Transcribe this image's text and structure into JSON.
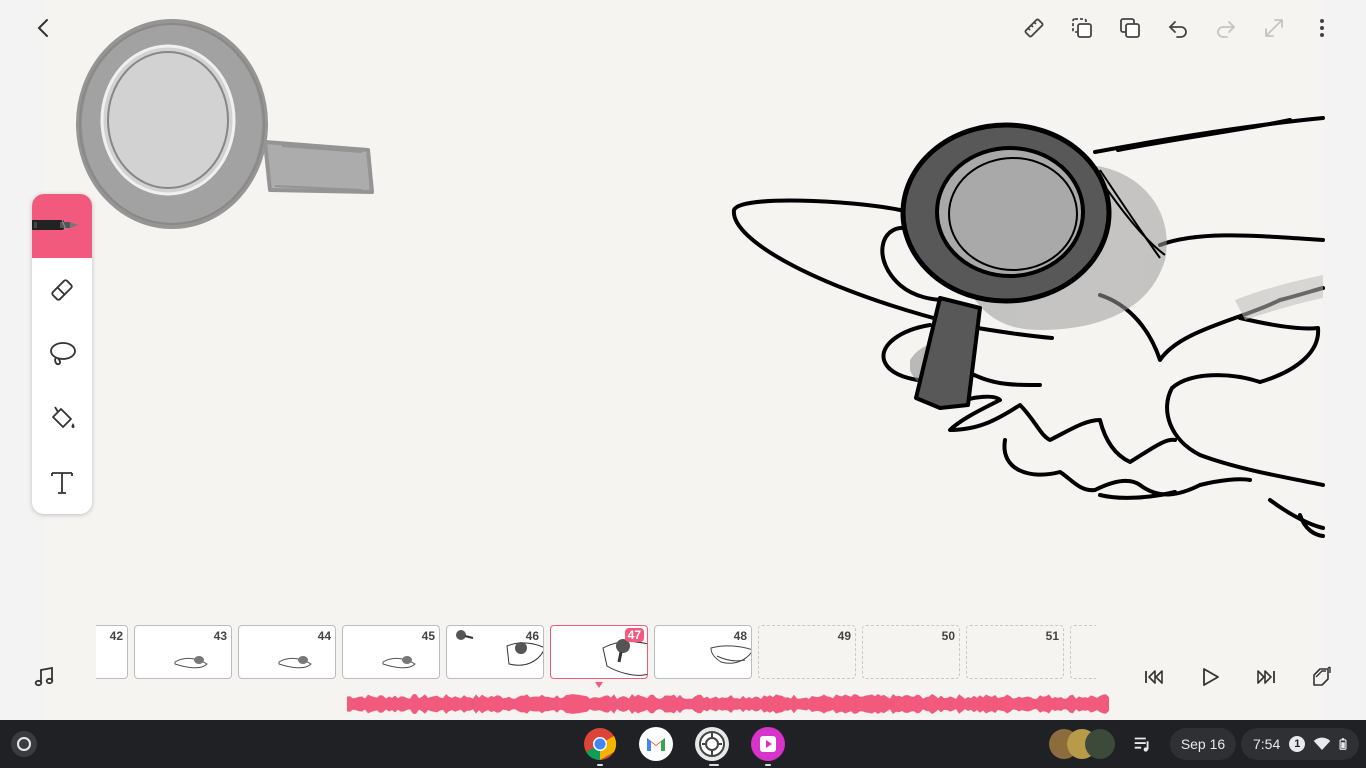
{
  "toolbar": {
    "back_icon": "chevron-left-icon",
    "ruler_icon": "ruler-icon",
    "onion_icon": "onion-skin-icon",
    "copy_icon": "duplicate-icon",
    "undo_icon": "undo-icon",
    "redo_icon": "redo-icon",
    "fullscreen_icon": "expand-icon",
    "more_icon": "more-vert-icon"
  },
  "tools": [
    {
      "name": "pen",
      "icon": "pen-icon",
      "active": true
    },
    {
      "name": "eraser",
      "icon": "eraser-icon",
      "active": false
    },
    {
      "name": "lasso",
      "icon": "lasso-icon",
      "active": false
    },
    {
      "name": "fill",
      "icon": "paint-bucket-icon",
      "active": false
    },
    {
      "name": "text",
      "icon": "text-icon",
      "active": false
    }
  ],
  "frames": [
    {
      "num": "42",
      "content": "partial"
    },
    {
      "num": "43",
      "content": "small"
    },
    {
      "num": "44",
      "content": "small"
    },
    {
      "num": "45",
      "content": "small"
    },
    {
      "num": "46",
      "content": "medium"
    },
    {
      "num": "47",
      "content": "current"
    },
    {
      "num": "48",
      "content": "hand"
    },
    {
      "num": "49",
      "content": "empty"
    },
    {
      "num": "50",
      "content": "empty"
    },
    {
      "num": "51",
      "content": "empty"
    }
  ],
  "current_frame": "47",
  "playback": {
    "music_icon": "music-note-icon",
    "first_icon": "skip-to-start-icon",
    "play_icon": "play-icon",
    "last_icon": "skip-to-end-icon",
    "layers_icon": "add-frames-icon"
  },
  "colors": {
    "accent": "#f15a7c",
    "shelf": "#1f2124",
    "paper": "#f5f4f1"
  },
  "shelf": {
    "launcher_icon": "launcher-circle-icon",
    "apps": [
      "chrome-icon",
      "gmail-icon",
      "camera-app-icon",
      "animation-app-icon"
    ],
    "tray_icon": "playlist-icon",
    "date": "Sep 16",
    "time": "7:54",
    "notification_count": "1",
    "wifi_icon": "wifi-icon",
    "battery_icon": "battery-icon"
  }
}
